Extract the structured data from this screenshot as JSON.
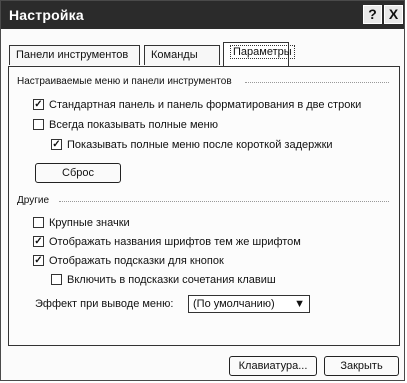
{
  "window": {
    "title": "Настройка",
    "help_glyph": "?",
    "close_glyph": "X"
  },
  "tabs": [
    {
      "label": "Панели инструментов"
    },
    {
      "label": "Команды"
    },
    {
      "label": "Параметры",
      "active": true
    }
  ],
  "section_menus": {
    "label": "Настраиваемые меню и панели инструментов",
    "options": [
      {
        "label": "Стандартная панель и панель форматирования в две строки",
        "checked": true
      },
      {
        "label": "Всегда показывать полные меню",
        "checked": false
      },
      {
        "label": "Показывать полные меню после короткой задержки",
        "checked": true
      }
    ],
    "reset_button": "Сброс"
  },
  "section_other": {
    "label": "Другие",
    "options": [
      {
        "label": "Крупные значки",
        "checked": false
      },
      {
        "label": "Отображать названия шрифтов тем же шрифтом",
        "checked": true
      },
      {
        "label": "Отображать подсказки для кнопок",
        "checked": true
      },
      {
        "label": "Включить в подсказки сочетания клавиш",
        "checked": false
      }
    ],
    "menu_effect_label": "Эффект при выводе меню:",
    "menu_effect_value": "(По умолчанию)"
  },
  "footer": {
    "keyboard_button": "Клавиатура...",
    "close_button": "Закрыть"
  },
  "icons": {
    "check": "✓",
    "dropdown": "▼"
  }
}
